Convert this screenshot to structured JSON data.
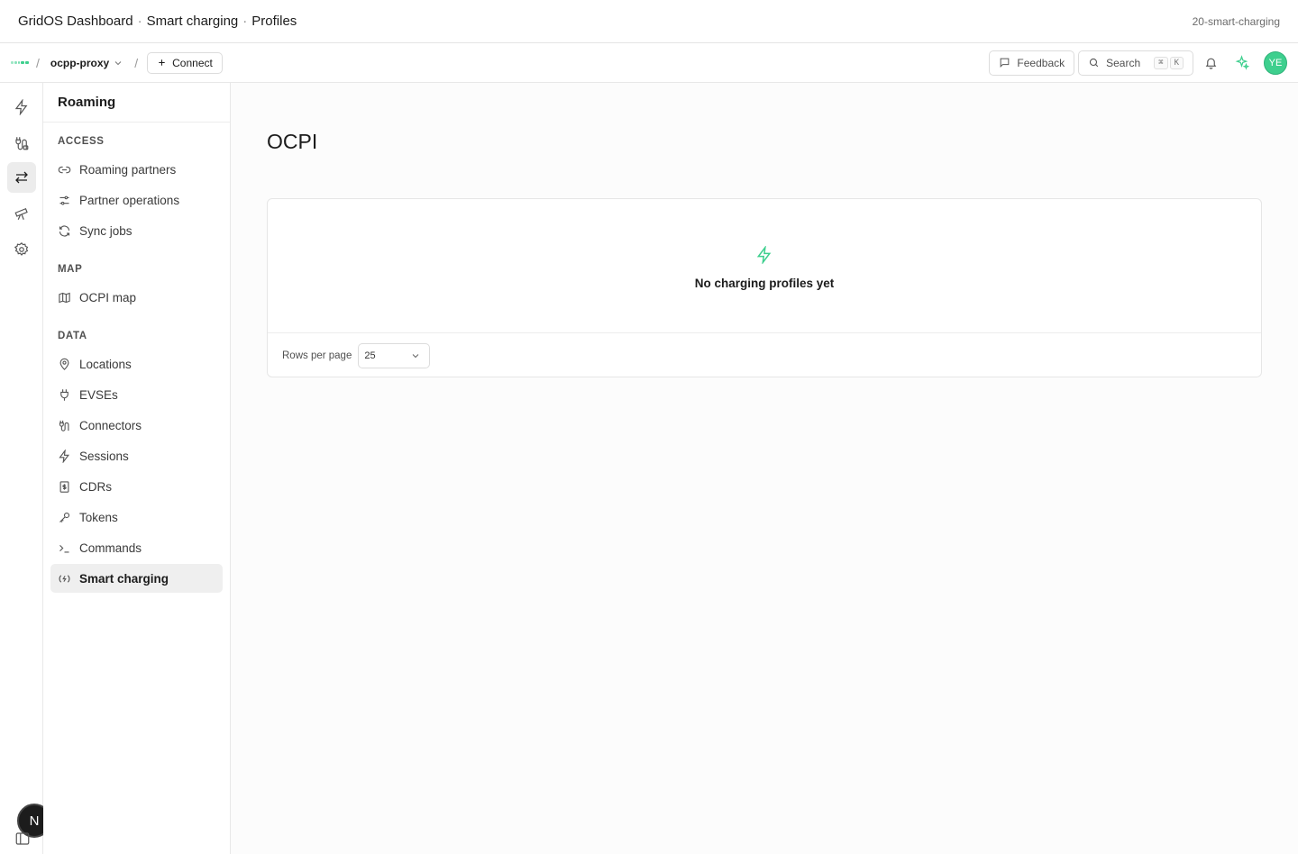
{
  "titlebar": {
    "app": "GridOS Dashboard",
    "sep": "·",
    "section": "Smart charging",
    "sep2": "·",
    "page": "Profiles",
    "branch": "20-smart-charging"
  },
  "header": {
    "slash": "/",
    "project": "ocpp-proxy",
    "slash2": "/",
    "connect_label": "Connect",
    "feedback_label": "Feedback",
    "search_label": "Search",
    "kbd_cmd": "⌘",
    "kbd_key": "K",
    "avatar_initials": "YE"
  },
  "rail": {
    "bottom_badge": "N"
  },
  "sidebar": {
    "title": "Roaming",
    "sections": [
      {
        "title": "ACCESS",
        "items": [
          "Roaming partners",
          "Partner operations",
          "Sync jobs"
        ]
      },
      {
        "title": "MAP",
        "items": [
          "OCPI map"
        ]
      },
      {
        "title": "DATA",
        "items": [
          "Locations",
          "EVSEs",
          "Connectors",
          "Sessions",
          "CDRs",
          "Tokens",
          "Commands",
          "Smart charging"
        ]
      }
    ],
    "active_item": "Smart charging"
  },
  "main": {
    "page_title": "OCPI",
    "empty_text": "No charging profiles yet",
    "rows_per_page_label": "Rows per page",
    "rows_per_page_value": "25"
  },
  "colors": {
    "accent": "#3ecf8e"
  }
}
